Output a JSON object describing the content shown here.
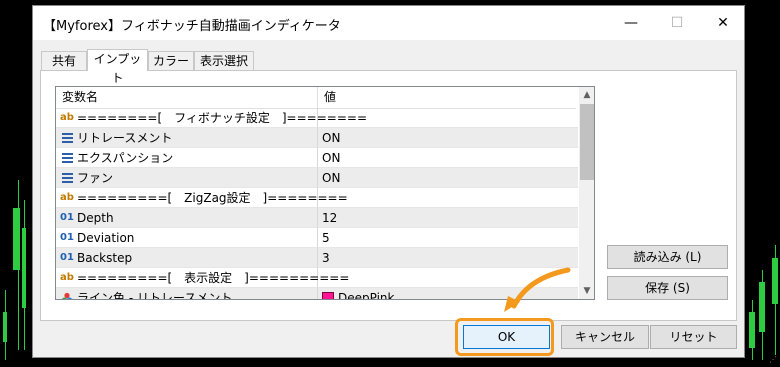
{
  "window": {
    "title": "【Myforex】フィボナッチ自動描画インディケータ",
    "minimize": "—",
    "maximize": "☐",
    "close": "✕"
  },
  "tabs": [
    {
      "label": "共有",
      "active": false
    },
    {
      "label": "インプット",
      "active": true
    },
    {
      "label": "カラー",
      "active": false
    },
    {
      "label": "表示選択",
      "active": false
    }
  ],
  "grid": {
    "headers": {
      "name": "変数名",
      "value": "値"
    },
    "rows": [
      {
        "icon": "ab-icon",
        "name": "========[　フィボナッチ設定　]========",
        "value": "",
        "shaded": false
      },
      {
        "icon": "list-icon",
        "name": "リトレースメント",
        "value": "ON",
        "shaded": true
      },
      {
        "icon": "list-icon",
        "name": "エクスパンション",
        "value": "ON",
        "shaded": false
      },
      {
        "icon": "list-icon",
        "name": "ファン",
        "value": "ON",
        "shaded": true
      },
      {
        "icon": "ab-icon",
        "name": "=========[　ZigZag設定　]========",
        "value": "",
        "shaded": false
      },
      {
        "icon": "01-icon",
        "name": "Depth",
        "value": "12",
        "shaded": true
      },
      {
        "icon": "01-icon",
        "name": "Deviation",
        "value": "5",
        "shaded": false
      },
      {
        "icon": "01-icon",
        "name": "Backstep",
        "value": "3",
        "shaded": true
      },
      {
        "icon": "ab-icon",
        "name": "=========[　表示設定　]==========",
        "value": "",
        "shaded": false
      },
      {
        "icon": "color-icon",
        "name": "ライン色 - リトレースメント",
        "value": "DeepPink",
        "shaded": true,
        "color": "#FF1493"
      }
    ]
  },
  "buttons": {
    "load": "読み込み (L)",
    "save": "保存 (S)",
    "ok": "OK",
    "cancel": "キャンセル",
    "reset": "リセット"
  },
  "colors": {
    "highlight": "#F39A1E",
    "ok_border": "#0078D7",
    "chart_candles": "#2ECC40"
  }
}
